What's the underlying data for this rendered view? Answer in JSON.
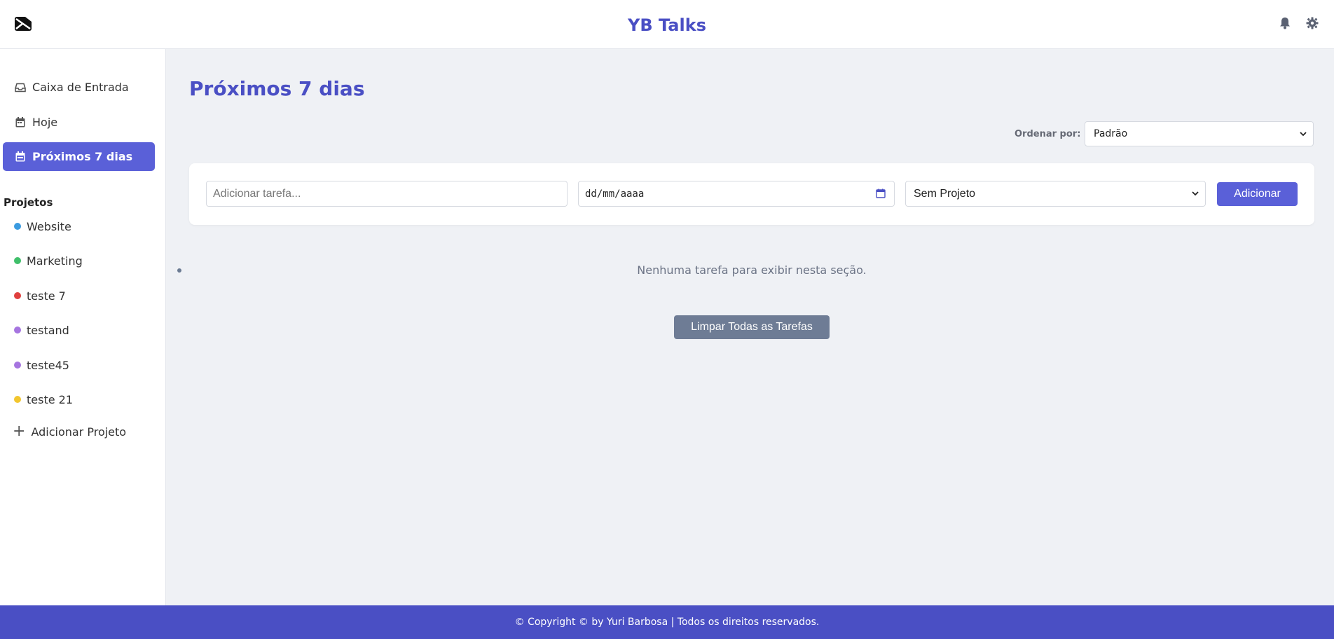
{
  "header": {
    "title": "YB Talks",
    "logo_icon": "envelope-logo-icon",
    "notification_icon": "bell-icon",
    "settings_icon": "gear-icon"
  },
  "sidebar": {
    "items": [
      {
        "label": "Caixa de Entrada",
        "icon": "inbox-icon",
        "active": false
      },
      {
        "label": "Hoje",
        "icon": "calendar-icon",
        "active": false
      },
      {
        "label": "Próximos 7 dias",
        "icon": "calendar-week-icon",
        "active": true
      }
    ],
    "projects_title": "Projetos",
    "projects": [
      {
        "label": "Website",
        "color": "#3b9be0"
      },
      {
        "label": "Marketing",
        "color": "#3fbf6a"
      },
      {
        "label": "teste 7",
        "color": "#e0403e"
      },
      {
        "label": "testand",
        "color": "#a675e0"
      },
      {
        "label": "teste45",
        "color": "#a675e0"
      },
      {
        "label": "teste 21",
        "color": "#f2c62e"
      }
    ],
    "add_project_label": "Adicionar Projeto"
  },
  "main": {
    "title": "Próximos 7 dias",
    "sort_label": "Ordenar por:",
    "sort_value": "Padrão",
    "task_input_placeholder": "Adicionar tarefa...",
    "date_placeholder": "dd/mm/aaaa",
    "project_select_value": "Sem Projeto",
    "add_button": "Adicionar",
    "empty_message": "Nenhuma tarefa para exibir nesta seção.",
    "clear_button": "Limpar Todas as Tarefas"
  },
  "footer": {
    "text": "© Copyright © by Yuri Barbosa | Todos os direitos reservados."
  },
  "colors": {
    "accent": "#5a60d8",
    "brand": "#4a4fc4",
    "clear_button": "#6e7c95"
  }
}
